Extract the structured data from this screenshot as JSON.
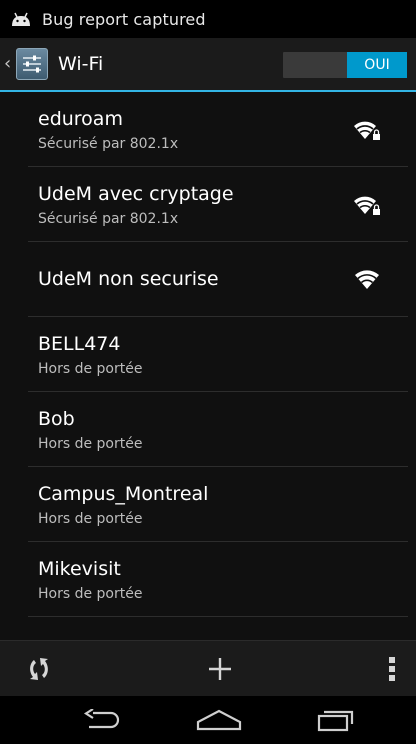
{
  "status_bar": {
    "notification_icon": "android-icon",
    "text": "Bug report captured"
  },
  "action_bar": {
    "up_icon": "chevron-left-icon",
    "app_icon": "wifi-settings-icon",
    "title": "Wi-Fi",
    "toggle": {
      "state_label": "OUI",
      "on": true
    },
    "accent_color": "#33b5e5"
  },
  "networks": [
    {
      "name": "eduroam",
      "status": "Sécurisé par 802.1x",
      "signal_icon": "wifi-lock-icon",
      "secured": true
    },
    {
      "name": "UdeM avec cryptage",
      "status": "Sécurisé par 802.1x",
      "signal_icon": "wifi-lock-icon",
      "secured": true
    },
    {
      "name": "UdeM non securise",
      "status": "",
      "signal_icon": "wifi-icon",
      "secured": false
    },
    {
      "name": "BELL474",
      "status": "Hors de portée"
    },
    {
      "name": "Bob",
      "status": "Hors de portée"
    },
    {
      "name": "Campus_Montreal",
      "status": "Hors de portée"
    },
    {
      "name": "Mikevisit",
      "status": "Hors de portée"
    }
  ],
  "bottom_bar": {
    "scan_icon": "wps-icon",
    "add_icon": "add-network-icon",
    "menu_icon": "overflow-menu-icon"
  },
  "nav_bar": {
    "back_icon": "back-icon",
    "home_icon": "home-icon",
    "recents_icon": "recents-icon"
  }
}
